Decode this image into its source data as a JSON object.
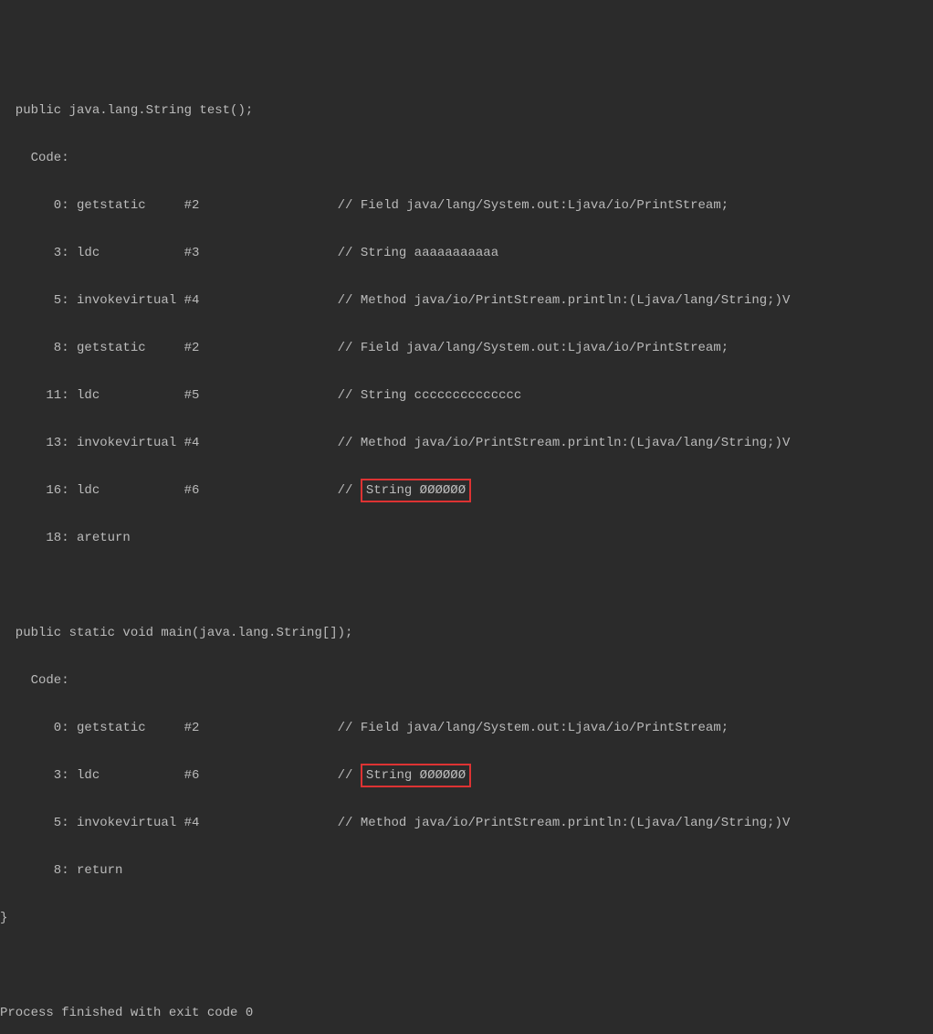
{
  "method1": {
    "signature": "  public java.lang.String test();",
    "codeLabel": "    Code:",
    "instructions": [
      {
        "offset": "       0: getstatic     #2                  // Field java/lang/System.out:Ljava/io/PrintStream;"
      },
      {
        "offset": "       3: ldc           #3                  // String aaaaaaaaaaa"
      },
      {
        "offset": "       5: invokevirtual #4                  // Method java/io/PrintStream.println:(Ljava/lang/String;)V"
      },
      {
        "offset": "       8: getstatic     #2                  // Field java/lang/System.out:Ljava/io/PrintStream;"
      },
      {
        "offset": "      11: ldc           #5                  // String cccccccccccccc"
      },
      {
        "offset": "      13: invokevirtual #4                  // Method java/io/PrintStream.println:(Ljava/lang/String;)V"
      },
      {
        "prefix": "      16: ldc           #6                  // ",
        "highlighted": "String ØØØØØØ"
      },
      {
        "offset": "      18: areturn"
      }
    ]
  },
  "method2": {
    "signature": "  public static void main(java.lang.String[]);",
    "codeLabel": "    Code:",
    "instructions": [
      {
        "offset": "       0: getstatic     #2                  // Field java/lang/System.out:Ljava/io/PrintStream;"
      },
      {
        "prefix": "       3: ldc           #6                  // ",
        "highlighted": "String ØØØØØØ"
      },
      {
        "offset": "       5: invokevirtual #4                  // Method java/io/PrintStream.println:(Ljava/lang/String;)V"
      },
      {
        "offset": "       8: return"
      }
    ]
  },
  "closingBrace": "}",
  "exitMessage": "Process finished with exit code 0"
}
